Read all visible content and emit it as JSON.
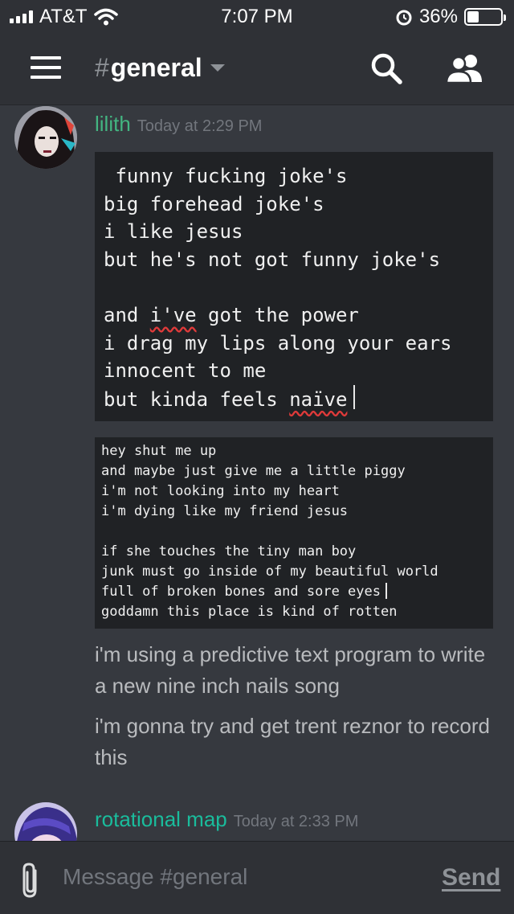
{
  "status_bar": {
    "carrier": "AT&T",
    "time": "7:07 PM",
    "battery_percent": "36%",
    "battery_level": 0.36,
    "icons": [
      "signal-icon",
      "wifi-icon",
      "alarm-icon",
      "battery-icon"
    ]
  },
  "header": {
    "channel_hash": "#",
    "channel_name": "general",
    "icons": [
      "menu-icon",
      "chevron-down-icon",
      "search-icon",
      "members-icon"
    ]
  },
  "messages": [
    {
      "author": "lilith",
      "author_color": "#43b581",
      "timestamp": "Today at 2:29 PM",
      "code_block_1": [
        " funny fucking joke's",
        "big forehead joke's",
        "i like jesus",
        "but he's not got funny joke's",
        "",
        "and i've got the power",
        "i drag my lips along your ears",
        "innocent to me",
        "but kinda feels naïve"
      ],
      "code_block_2": [
        "hey shut me up",
        "and maybe just give me a little piggy",
        "i'm not looking into my heart",
        "i'm dying like my friend jesus",
        "",
        "if she touches the tiny man boy",
        "junk must go inside of my beautiful world",
        "full of broken bones and sore eyes",
        "goddamn this place is kind of rotten"
      ],
      "text_1": "i'm using a predictive text program to write a new nine inch nails song",
      "text_2": "i'm gonna try and get trent reznor to record this"
    },
    {
      "author": "rotational map",
      "author_color": "#1abc9c",
      "timestamp": "Today at 2:33 PM"
    }
  ],
  "composer": {
    "placeholder": "Message #general",
    "send_label": "Send",
    "icons": [
      "paperclip-icon"
    ]
  }
}
